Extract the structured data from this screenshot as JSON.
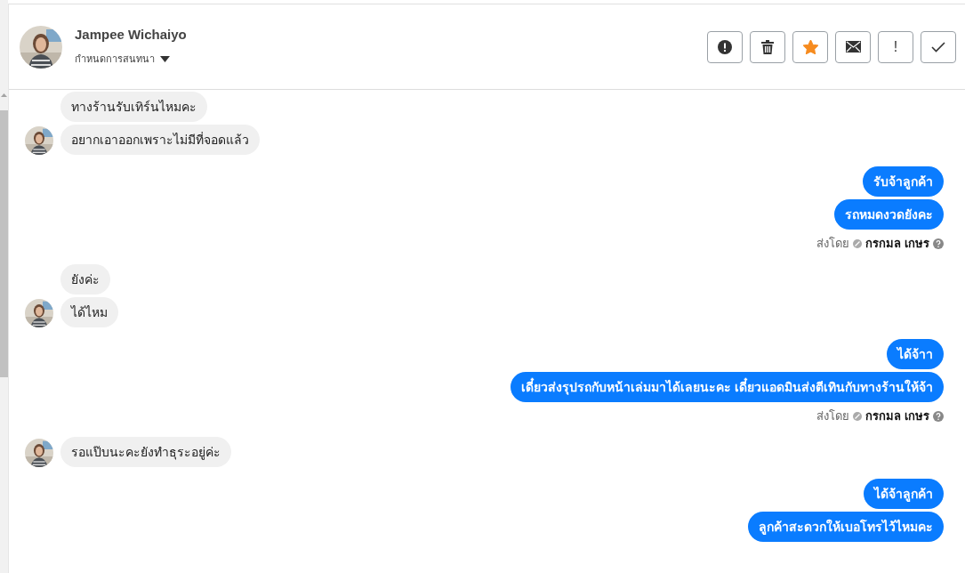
{
  "contact": {
    "name": "Jampee Wichaiyo",
    "menu_label": "กำหนดการสนทนา"
  },
  "actions": [
    {
      "kind": "alert"
    },
    {
      "kind": "trash"
    },
    {
      "kind": "star",
      "on": true
    },
    {
      "kind": "mail"
    },
    {
      "kind": "text",
      "label": "!"
    },
    {
      "kind": "check"
    }
  ],
  "groups": [
    {
      "kind": "incoming",
      "messages": [
        "ทางร้านรับเทิร์นไหมคะ",
        "อยากเอาออกเพราะไม่มีที่จอดแล้ว"
      ]
    },
    {
      "kind": "outgoing",
      "messages": [
        "รับจ้าลูกค้า",
        "รถหมดงวดยังคะ"
      ],
      "sent_by_label": "ส่งโดย",
      "sender": "กรกมล เกษร"
    },
    {
      "kind": "incoming",
      "messages": [
        "ยังค่ะ",
        "ได้ไหม"
      ]
    },
    {
      "kind": "outgoing",
      "messages": [
        "ได้จ้าา",
        "เดี๋ยวส่งรุปรถกับหน้าเล่มมาได้เลยนะคะ  เดี๋ยวแอดมินส่งตีเทินกับทางร้านให้จ้า"
      ],
      "sent_by_label": "ส่งโดย",
      "sender": "กรกมล เกษร"
    },
    {
      "kind": "incoming",
      "messages": [
        "รอแป๊บนะคะยังทำธุระอยู่ค่ะ"
      ]
    },
    {
      "kind": "outgoing",
      "messages": [
        "ได้จ้าลูกค้า",
        "ลูกค้าสะดวกให้เบอโทรไว้ไหมคะ"
      ]
    }
  ]
}
